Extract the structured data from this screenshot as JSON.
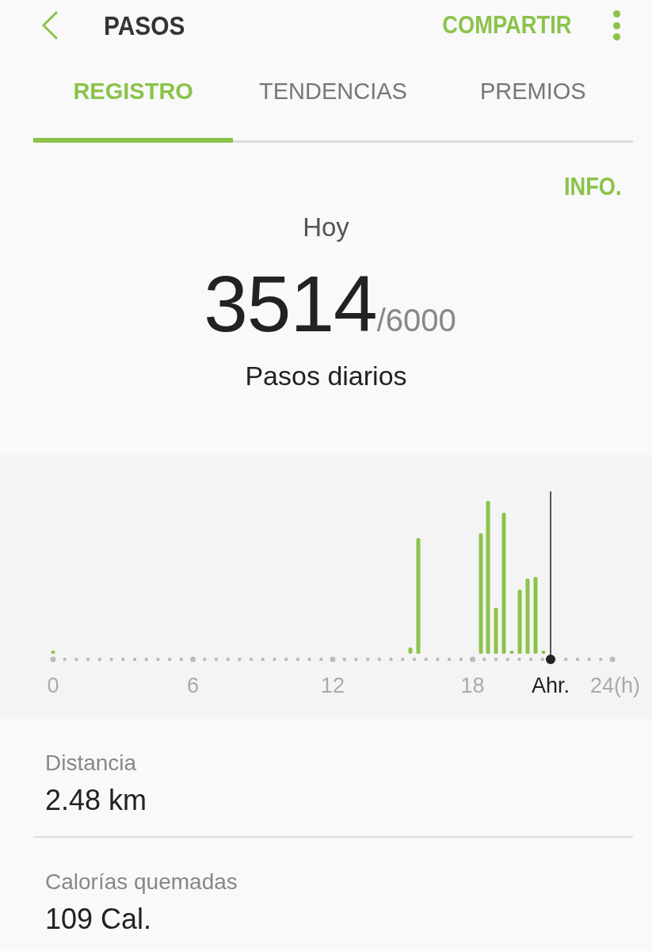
{
  "header": {
    "title": "PASOS",
    "action": "COMPARTIR"
  },
  "tabs": [
    {
      "label": "REGISTRO",
      "selected": true
    },
    {
      "label": "TENDENCIAS",
      "selected": false
    },
    {
      "label": "PREMIOS",
      "selected": false
    }
  ],
  "info_link": "INFO.",
  "summary": {
    "period": "Hoy",
    "steps": "3514",
    "goal": "/6000",
    "caption": "Pasos diarios"
  },
  "chart": {
    "hour_labels": [
      "0",
      "6",
      "12",
      "18"
    ],
    "now_label": "Ahr.",
    "end_label": "24(h)"
  },
  "stats": [
    {
      "label": "Distancia",
      "value": "2.48 km"
    },
    {
      "label": "Calorías quemadas",
      "value": "109 Cal."
    }
  ]
}
